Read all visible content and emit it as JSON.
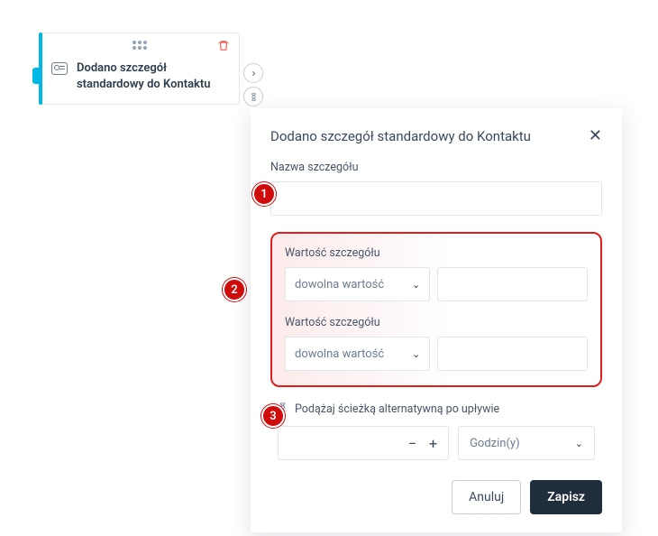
{
  "card": {
    "title": "Dodano szczegół standardowy do Kontaktu"
  },
  "panel": {
    "title": "Dodano szczegół standardowy do Kontaktu",
    "fields": {
      "name_label": "Nazwa szczegółu",
      "value1_label": "Wartość szczegółu",
      "value1_select": "dowolna wartość",
      "value2_label": "Wartość szczegółu",
      "value2_select": "dowolna wartość"
    },
    "altpath_label": "Podążaj ścieżką alternatywną po upływie",
    "time_unit": "Godzin(y)",
    "actions": {
      "cancel": "Anuluj",
      "save": "Zapisz"
    }
  },
  "callouts": {
    "one": "1",
    "two": "2",
    "three": "3"
  }
}
